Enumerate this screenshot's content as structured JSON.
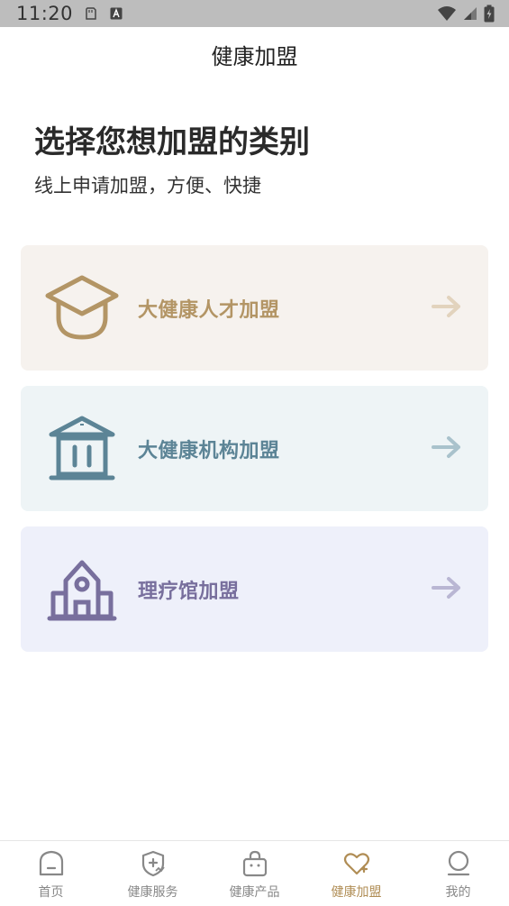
{
  "status_bar": {
    "time": "11:20",
    "icons": [
      "sd-card-icon",
      "keyboard-a-icon",
      "wifi-icon",
      "signal-icon",
      "battery-charging-icon"
    ]
  },
  "header": {
    "title": "健康加盟"
  },
  "intro": {
    "heading": "选择您想加盟的类别",
    "subheading": "线上申请加盟，方便、快捷"
  },
  "options": [
    {
      "label": "大健康人才加盟",
      "icon": "graduation-cap-icon",
      "bg": "#f6f2ee",
      "color": "#b39565",
      "arrow": "#e2d3bd"
    },
    {
      "label": "大健康机构加盟",
      "icon": "institution-building-icon",
      "bg": "#eef4f6",
      "color": "#5c8496",
      "arrow": "#a9c2cc"
    },
    {
      "label": "理疗馆加盟",
      "icon": "clinic-house-icon",
      "bg": "#eef0fa",
      "color": "#786f9d",
      "arrow": "#b9b6d3"
    }
  ],
  "tabbar": {
    "items": [
      {
        "label": "首页",
        "icon": "home-icon",
        "active": false
      },
      {
        "label": "健康服务",
        "icon": "shield-plus-icon",
        "active": false
      },
      {
        "label": "健康产品",
        "icon": "shopping-bag-icon",
        "active": false
      },
      {
        "label": "健康加盟",
        "icon": "heart-plus-icon",
        "active": true
      },
      {
        "label": "我的",
        "icon": "profile-icon",
        "active": false
      }
    ],
    "active_color": "#b08d55",
    "inactive_color": "#888888"
  }
}
